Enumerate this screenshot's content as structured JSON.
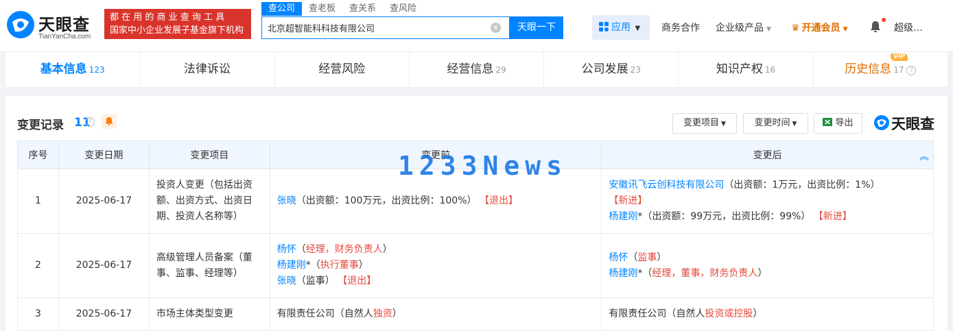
{
  "header": {
    "logo_text": "天眼查",
    "logo_sub": "TianYanCha.com",
    "banner_line1": "都 在 用 的 商 业 查 询 工 具",
    "banner_line2": "国家中小企业发展子基金旗下机构",
    "search_tabs": [
      "查公司",
      "查老板",
      "查关系",
      "查风险"
    ],
    "search_value": "北京超智能科科技有限公司",
    "search_button": "天眼一下",
    "apps_label": "应用",
    "nav": [
      "商务合作",
      "企业级产品",
      "开通会员"
    ],
    "username": "超级…"
  },
  "tabs": [
    {
      "label": "基本信息",
      "count": "123"
    },
    {
      "label": "法律诉讼",
      "count": ""
    },
    {
      "label": "经营风险",
      "count": ""
    },
    {
      "label": "经营信息",
      "count": "29"
    },
    {
      "label": "公司发展",
      "count": "23"
    },
    {
      "label": "知识产权",
      "count": "16"
    },
    {
      "label": "历史信息",
      "count": "17",
      "badge": "VIP"
    }
  ],
  "section": {
    "title": "变更记录",
    "count": "11",
    "btn_item": "变更项目",
    "btn_time": "变更时间",
    "btn_export": "导出",
    "brand": "天眼查"
  },
  "table": {
    "headers": [
      "序号",
      "变更日期",
      "变更项目",
      "变更前",
      "变更后"
    ],
    "rows": [
      {
        "no": "1",
        "date": "2025-06-17",
        "item": "投资人变更（包括出资额、出资方式、出资日期、投资人名称等）",
        "before": {
          "name": "张晓",
          "detail": "（出资额：100万元，出资比例：100%）",
          "tag": "【退出】"
        },
        "after": [
          {
            "name": "安徽讯飞云创科技有限公司",
            "detail": "（出资额：1万元，出资比例：1%）",
            "tag": "【新进】"
          },
          {
            "name": "杨建刚",
            "star": "*",
            "detail": "（出资额：99万元，出资比例：99%）",
            "tag": "【新进】"
          }
        ]
      },
      {
        "no": "2",
        "date": "2025-06-17",
        "item": "高级管理人员备案（董事、监事、经理等）",
        "before": [
          {
            "name": "杨怀",
            "open": "（",
            "roles": "经理，财务负责人",
            "close": "）"
          },
          {
            "name": "杨建刚",
            "star": "*",
            "open": "（",
            "roles": "执行董事",
            "close": "）"
          },
          {
            "name": "张晓",
            "plain": "（监事）",
            "tag": "【退出】"
          }
        ],
        "after": [
          {
            "name": "杨怀",
            "open": "（",
            "roles": "监事",
            "close": "）"
          },
          {
            "name": "杨建刚",
            "star": "*",
            "open": "（",
            "roles": "经理，董事，财务负责人",
            "close": "）"
          }
        ]
      },
      {
        "no": "3",
        "date": "2025-06-17",
        "item": "市场主体类型变更",
        "before": {
          "plain": "有限责任公司（自然人",
          "hl": "独资",
          "close": "）"
        },
        "after": {
          "plain": "有限责任公司（自然人",
          "hl": "投资或控股",
          "close": "）"
        }
      }
    ]
  },
  "watermark": "1233News",
  "colors": {
    "brand": "#0084ff",
    "banner": "#d9342b",
    "vip": "#e06d00",
    "alert": "#e6483d"
  }
}
